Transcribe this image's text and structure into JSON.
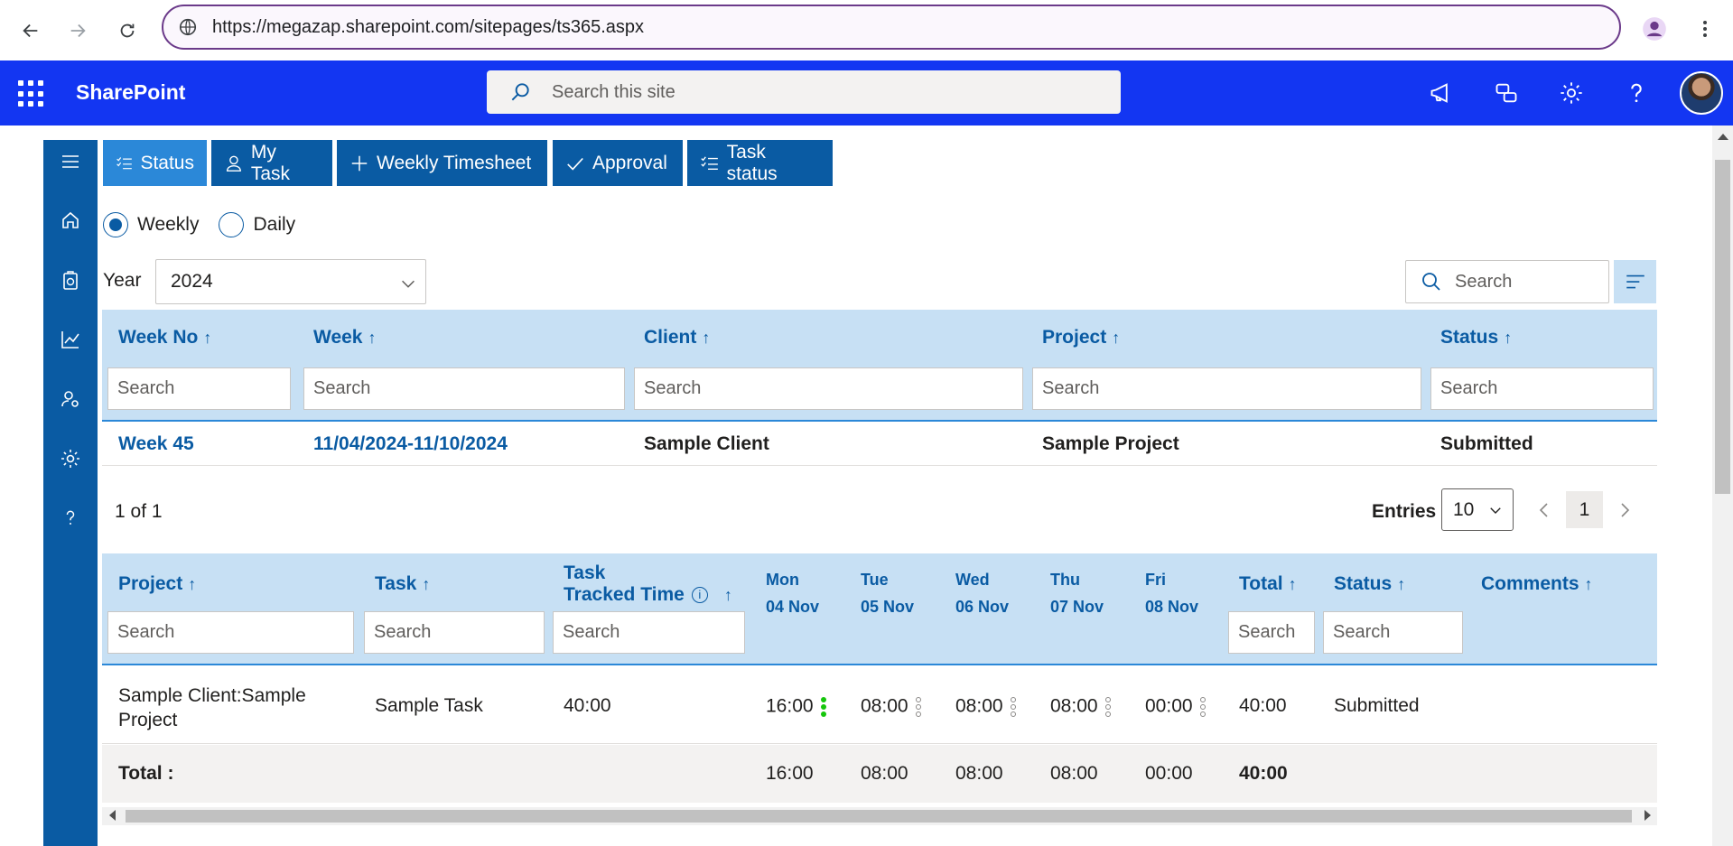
{
  "browser": {
    "url": "https://megazap.sharepoint.com/sitepages/ts365.aspx"
  },
  "suite": {
    "app_name": "SharePoint",
    "search_placeholder": "Search this site",
    "bar_color": "#1336f2"
  },
  "toolbar": {
    "tabs": [
      {
        "label": "Status",
        "icon": "checklist-icon",
        "active": true
      },
      {
        "label": "My Task",
        "icon": "person-icon",
        "active": false
      },
      {
        "label": "Weekly Timesheet",
        "icon": "plus-icon",
        "active": false
      },
      {
        "label": "Approval",
        "icon": "check-icon",
        "active": false
      },
      {
        "label": "Task status",
        "icon": "checklist-icon",
        "active": false
      }
    ]
  },
  "view_mode": {
    "options": [
      "Weekly",
      "Daily"
    ],
    "selected": "Weekly"
  },
  "filters": {
    "year_label": "Year",
    "year_value": "2024",
    "search_placeholder": "Search"
  },
  "weekly_table": {
    "columns": [
      "Week No",
      "Week",
      "Client",
      "Project",
      "Status"
    ],
    "search_placeholder": "Search",
    "rows": [
      {
        "week_no": "Week 45",
        "week": "11/04/2024-11/10/2024",
        "client": "Sample Client",
        "project": "Sample Project",
        "status": "Submitted"
      }
    ],
    "paging_text": "1 of 1",
    "entries_label": "Entries",
    "entries_value": "10",
    "current_page": "1"
  },
  "daily_table": {
    "columns": {
      "project": "Project",
      "task": "Task",
      "tracked_line1": "Task",
      "tracked_line2": "Tracked Time",
      "total": "Total",
      "status": "Status",
      "comments": "Comments"
    },
    "days": [
      {
        "day": "Mon",
        "date": "04 Nov"
      },
      {
        "day": "Tue",
        "date": "05 Nov"
      },
      {
        "day": "Wed",
        "date": "06 Nov"
      },
      {
        "day": "Thu",
        "date": "07 Nov"
      },
      {
        "day": "Fri",
        "date": "08 Nov"
      }
    ],
    "search_placeholder": "Search",
    "row": {
      "project_line1": "Sample Client:Sample",
      "project_line2": "Project",
      "task": "Sample Task",
      "tracked": "40:00",
      "hours": [
        "16:00",
        "08:00",
        "08:00",
        "08:00",
        "00:00"
      ],
      "total": "40:00",
      "status": "Submitted"
    },
    "totals": {
      "label": "Total :",
      "hours": [
        "16:00",
        "08:00",
        "08:00",
        "08:00",
        "00:00"
      ],
      "total": "40:00"
    }
  },
  "colors": {
    "accent": "#0a5ba3",
    "active_tab": "#2b88d8",
    "header_bg": "#c7e0f4"
  }
}
